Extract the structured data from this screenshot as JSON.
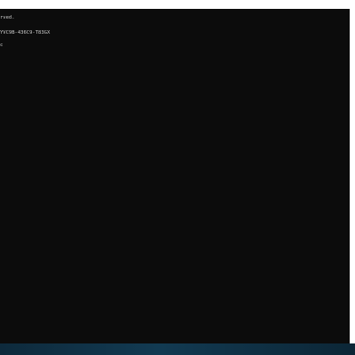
{
  "terminal": {
    "lines": [
      "rved.",
      "YVC9B-436C9-T83GX",
      "c"
    ]
  },
  "colors": {
    "terminal_bg": "#0c0c0c",
    "text": "#cccccc",
    "taskbar": "#123a52"
  }
}
